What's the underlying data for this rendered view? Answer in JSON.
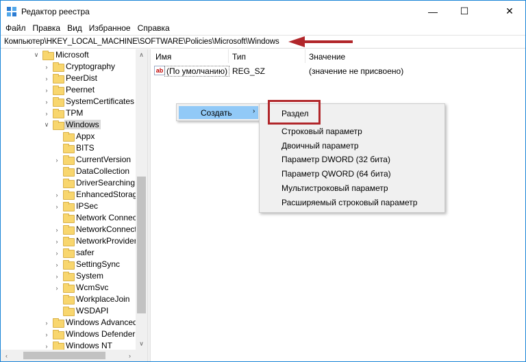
{
  "window": {
    "title": "Редактор реестра",
    "controls": {
      "minimize": "—",
      "maximize": "☐",
      "close": "✕"
    }
  },
  "menu": [
    "Файл",
    "Правка",
    "Вид",
    "Избранное",
    "Справка"
  ],
  "address": "Компьютер\\HKEY_LOCAL_MACHINE\\SOFTWARE\\Policies\\Microsoft\\Windows",
  "tree": {
    "microsoft": "Microsoft",
    "microsoft_children": [
      "Cryptography",
      "PeerDist",
      "Peernet",
      "SystemCertificates",
      "TPM"
    ],
    "selected": "Windows",
    "windows_children": [
      "Appx",
      "BITS",
      "CurrentVersion",
      "DataCollection",
      "DriverSearching",
      "EnhancedStorage",
      "IPSec",
      "Network Connect",
      "NetworkConnecti",
      "NetworkProvider",
      "safer",
      "SettingSync",
      "System",
      "WcmSvc",
      "WorkplaceJoin",
      "WSDAPI"
    ],
    "after": [
      "Windows Advanced",
      "Windows Defender",
      "Windows NT"
    ]
  },
  "columns": {
    "name": "Имя",
    "type": "Тип",
    "value": "Значение"
  },
  "values": [
    {
      "icon": "ab",
      "name": "(По умолчанию)",
      "type": "REG_SZ",
      "data": "(значение не присвоено)"
    }
  ],
  "context_menu": {
    "new": "Создать",
    "arrow": "›",
    "submenu": [
      "Раздел",
      "Строковый параметр",
      "Двоичный параметр",
      "Параметр DWORD (32 бита)",
      "Параметр QWORD (64 бита)",
      "Мультистроковый параметр",
      "Расширяемый строковый параметр"
    ]
  },
  "colors": {
    "accent": "#91c9f7",
    "highlight": "#b1262a",
    "folder": "#f8d66e",
    "window_border": "#1883d7"
  }
}
